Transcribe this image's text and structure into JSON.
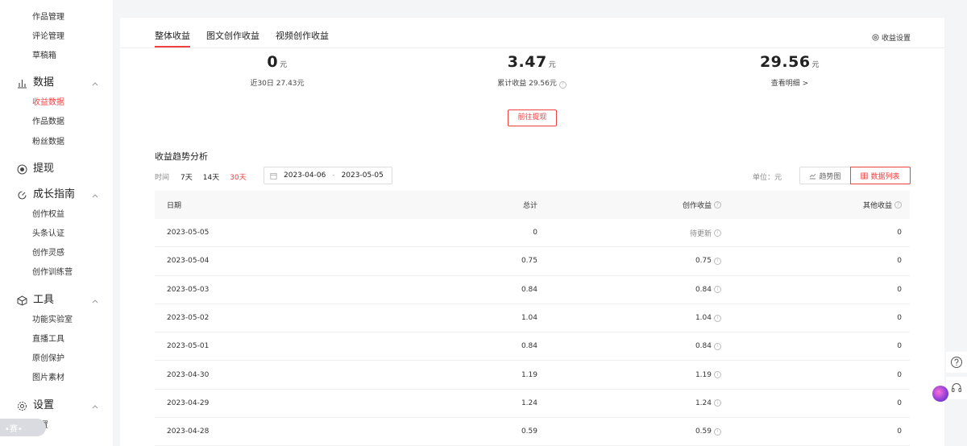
{
  "sidebar": {
    "top_items": [
      "作品管理",
      "评论管理",
      "草稿箱"
    ],
    "data_section": {
      "label": "数据",
      "items": [
        "收益数据",
        "作品数据",
        "粉丝数据"
      ],
      "active": "收益数据"
    },
    "withdraw_section": {
      "label": "提现"
    },
    "growth_section": {
      "label": "成长指南",
      "items": [
        "创作权益",
        "头条认证",
        "创作灵感",
        "创作训练营"
      ]
    },
    "tools_section": {
      "label": "工具",
      "items": [
        "功能实验室",
        "直播工具",
        "原创保护",
        "图片素材"
      ]
    },
    "settings_section": {
      "label": "设置",
      "items": [
        "设置"
      ]
    },
    "float_pill": "•赛•"
  },
  "tabs": [
    "整体收益",
    "图文创作收益",
    "视频创作收益"
  ],
  "active_tab": "整体收益",
  "settings_link": "收益设置",
  "stats": [
    {
      "value": "0",
      "unit": "元",
      "sub": "近30日 27.43元"
    },
    {
      "value": "3.47",
      "unit": "元",
      "sub": "累计收益 29.56元"
    },
    {
      "value": "29.56",
      "unit": "元",
      "sub": "查看明细 >"
    }
  ],
  "withdraw_button": "前往提现",
  "trend_title": "收益趋势分析",
  "filter": {
    "label": "时间",
    "options": [
      "7天",
      "14天",
      "30天"
    ],
    "active": "30天",
    "date_start": "2023-04-06",
    "date_sep": "-",
    "date_end": "2023-05-05"
  },
  "unit_label": "单位：元",
  "view_buttons": {
    "trend": "趋势图",
    "list": "数据列表"
  },
  "table": {
    "columns": [
      "日期",
      "总计",
      "创作收益",
      "其他收益"
    ],
    "rows": [
      {
        "date": "2023-05-05",
        "total": "0",
        "create": "待更新",
        "other": "0"
      },
      {
        "date": "2023-05-04",
        "total": "0.75",
        "create": "0.75",
        "other": "0"
      },
      {
        "date": "2023-05-03",
        "total": "0.84",
        "create": "0.84",
        "other": "0"
      },
      {
        "date": "2023-05-02",
        "total": "1.04",
        "create": "1.04",
        "other": "0"
      },
      {
        "date": "2023-05-01",
        "total": "0.84",
        "create": "0.84",
        "other": "0"
      },
      {
        "date": "2023-04-30",
        "total": "1.19",
        "create": "1.19",
        "other": "0"
      },
      {
        "date": "2023-04-29",
        "total": "1.24",
        "create": "1.24",
        "other": "0"
      },
      {
        "date": "2023-04-28",
        "total": "0.59",
        "create": "0.59",
        "other": "0"
      }
    ]
  },
  "colors": {
    "accent": "#f04142",
    "background": "#f4f5f6"
  }
}
